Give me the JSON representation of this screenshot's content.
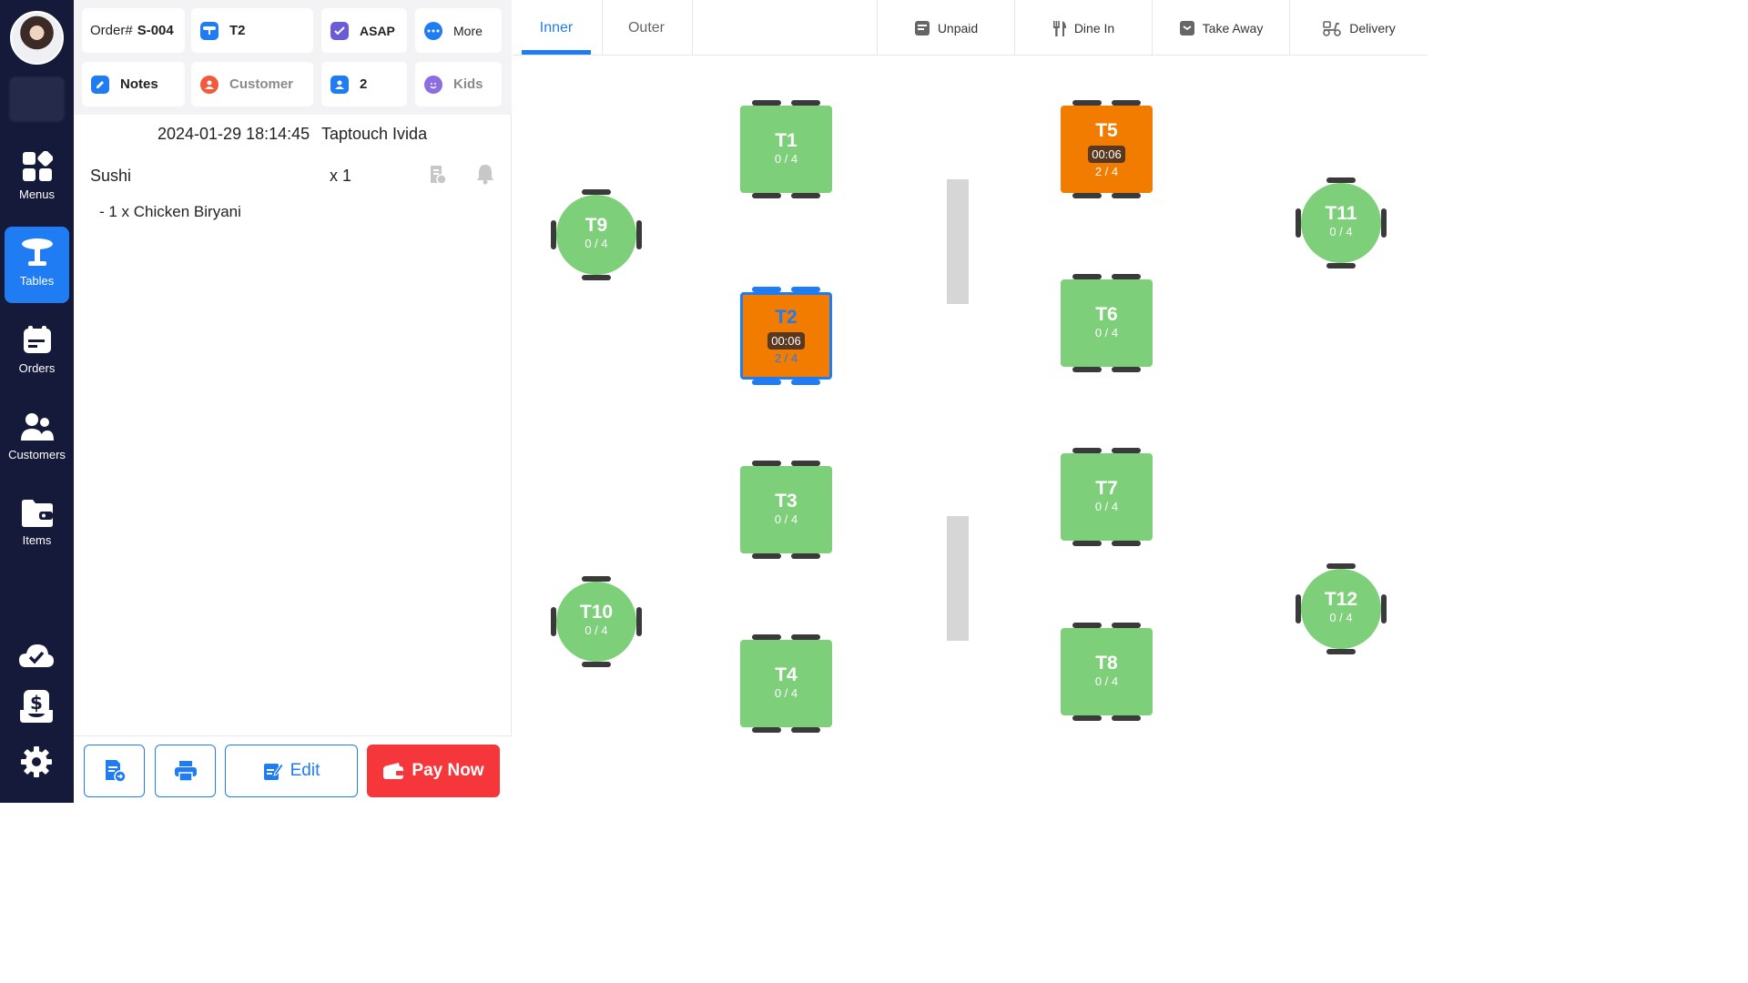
{
  "nav": {
    "items": [
      {
        "label": "Menus"
      },
      {
        "label": "Tables"
      },
      {
        "label": "Orders"
      },
      {
        "label": "Customers"
      },
      {
        "label": "Items"
      }
    ]
  },
  "order": {
    "number_prefix": "Order#",
    "number": "S-004",
    "table": "T2",
    "timing": "ASAP",
    "more_label": "More",
    "notes_label": "Notes",
    "customer_label": "Customer",
    "guests": "2",
    "kids_label": "Kids",
    "datetime": "2024-01-29 18:14:45",
    "store": "Taptouch Ivida",
    "items": [
      {
        "name": "Sushi",
        "qty": "x 1",
        "modifier": "- 1 x Chicken Biryani"
      }
    ]
  },
  "actions": {
    "edit_label": "Edit",
    "pay_label": "Pay Now"
  },
  "floor": {
    "tabs": [
      {
        "label": "Inner"
      },
      {
        "label": "Outer"
      }
    ],
    "filters": [
      {
        "label": "Unpaid"
      },
      {
        "label": "Dine In"
      },
      {
        "label": "Take Away"
      },
      {
        "label": "Delivery"
      }
    ],
    "tables": [
      {
        "name": "T1",
        "seats": "0 / 4"
      },
      {
        "name": "T2",
        "seats": "2 / 4",
        "timer": "00:06"
      },
      {
        "name": "T3",
        "seats": "0 / 4"
      },
      {
        "name": "T4",
        "seats": "0 / 4"
      },
      {
        "name": "T5",
        "seats": "2 / 4",
        "timer": "00:06"
      },
      {
        "name": "T6",
        "seats": "0 / 4"
      },
      {
        "name": "T7",
        "seats": "0 / 4"
      },
      {
        "name": "T8",
        "seats": "0 / 4"
      },
      {
        "name": "T9",
        "seats": "0 / 4"
      },
      {
        "name": "T10",
        "seats": "0 / 4"
      },
      {
        "name": "T11",
        "seats": "0 / 4"
      },
      {
        "name": "T12",
        "seats": "0 / 4"
      }
    ]
  },
  "colors": {
    "accent": "#1f7cf2",
    "nav_bg": "#161a3a",
    "table_free": "#7dcf7a",
    "table_busy": "#f27c00",
    "pay": "#f5363a"
  }
}
